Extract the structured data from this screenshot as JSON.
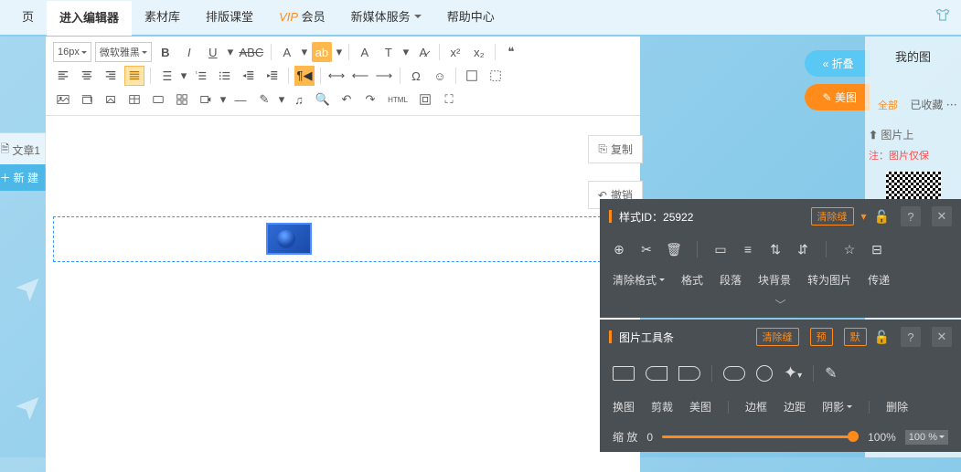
{
  "nav": {
    "home_suffix": "页",
    "editor": "进入编辑器",
    "material": "素材库",
    "layout": "排版课堂",
    "vip_prefix": "VIP",
    "vip_suffix": "会员",
    "media": "新媒体服务",
    "help": "帮助中心"
  },
  "toolbar": {
    "font_size": "16px",
    "font_family": "微软雅黑",
    "html_label": "HTML"
  },
  "left": {
    "article_tab": "文章1",
    "new_btn": "新 建"
  },
  "side": {
    "copy": "复制",
    "undo": "撤销"
  },
  "right": {
    "my_images": "我的图",
    "fold": "折叠",
    "beauty": "美图",
    "all": "全部",
    "favorited": "已收藏",
    "upload": "图片上",
    "note": "注：图片仅保"
  },
  "style_panel": {
    "title_prefix": "样式ID：",
    "style_id": "25922",
    "clear_gap": "清除缝",
    "clear_format": "清除格式",
    "format": "格式",
    "paragraph": "段落",
    "block_bg": "块背景",
    "to_image": "转为图片",
    "transfer": "传递"
  },
  "img_panel": {
    "title": "图片工具条",
    "clear_gap": "清除缝",
    "preview": "预",
    "default": "默",
    "swap": "换图",
    "crop": "剪裁",
    "beauty": "美图",
    "border": "边框",
    "margin": "边距",
    "shadow": "阴影",
    "delete": "删除",
    "zoom": "缩 放",
    "zoom_min": "0",
    "zoom_max": "100%",
    "zoom_val": "100 %"
  }
}
